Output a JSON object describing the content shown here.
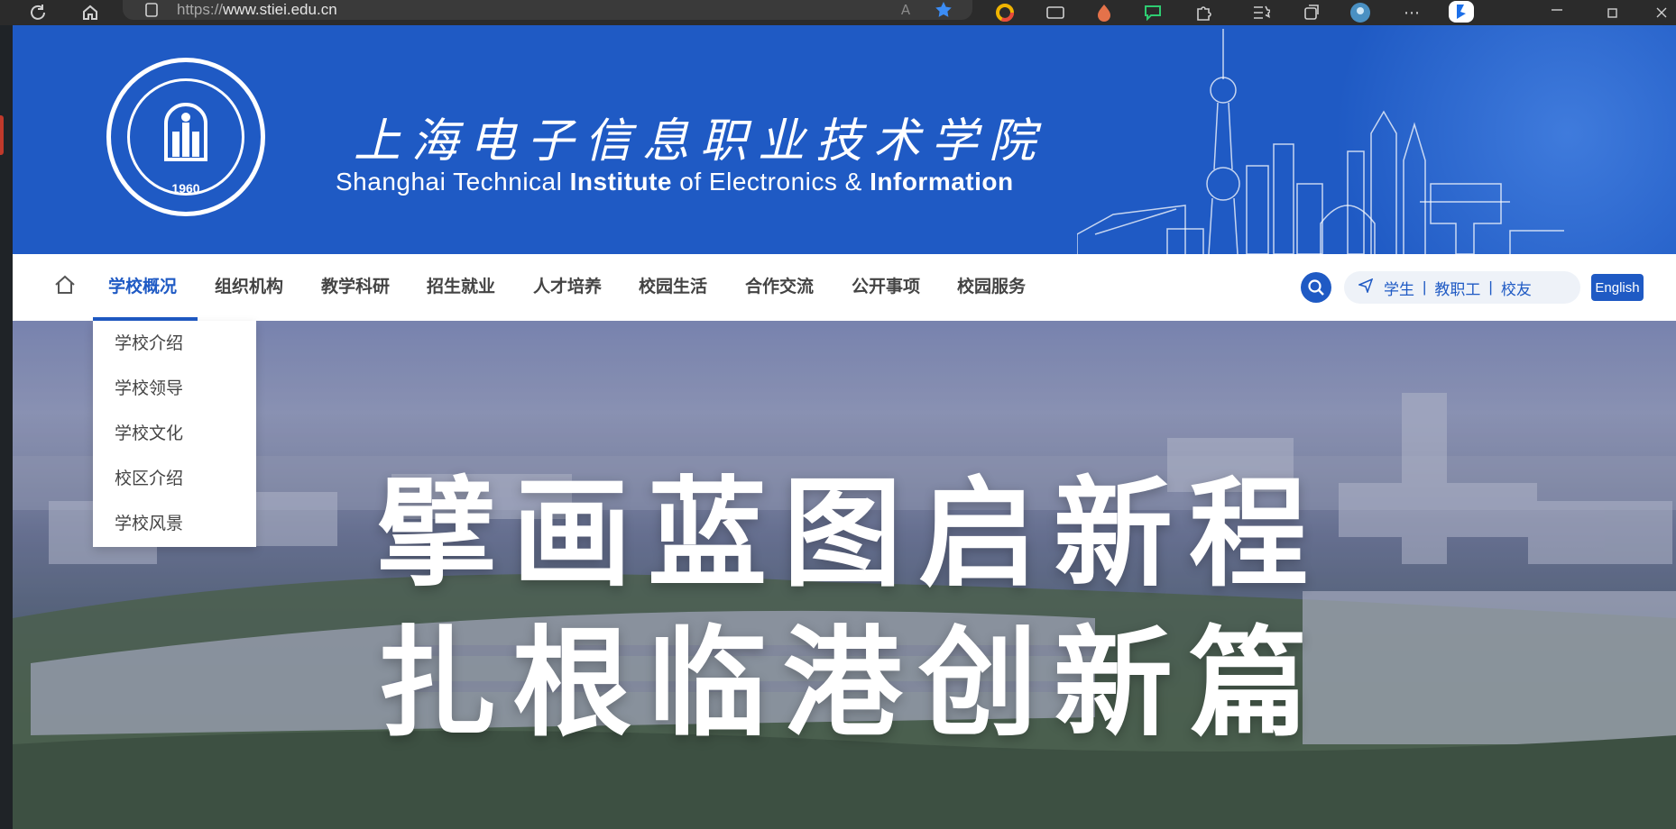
{
  "browser": {
    "url_prefix": "https://",
    "url_host": "www.stiei.edu.cn"
  },
  "site": {
    "name_cn": "上海电子信息职业技术学院",
    "name_en_parts": [
      "Shanghai Technical ",
      "Institute",
      " of Electronics & ",
      "Information"
    ],
    "logo_year": "1960"
  },
  "nav": {
    "items": [
      {
        "label": "学校概况",
        "active": true
      },
      {
        "label": "组织机构"
      },
      {
        "label": "教学科研"
      },
      {
        "label": "招生就业"
      },
      {
        "label": "人才培养"
      },
      {
        "label": "校园生活"
      },
      {
        "label": "合作交流"
      },
      {
        "label": "公开事项"
      },
      {
        "label": "校园服务"
      }
    ],
    "portal": [
      "学生",
      "教职工",
      "校友"
    ],
    "portal_separator": "|",
    "language": "English"
  },
  "dropdown": {
    "items": [
      "学校介绍",
      "学校领导",
      "学校文化",
      "校区介绍",
      "学校风景"
    ]
  },
  "hero": {
    "line1": "擘画蓝图启新程",
    "line2": "扎根临港创新篇"
  },
  "colors": {
    "brand": "#1f5ac4",
    "nav_text": "#444444"
  }
}
